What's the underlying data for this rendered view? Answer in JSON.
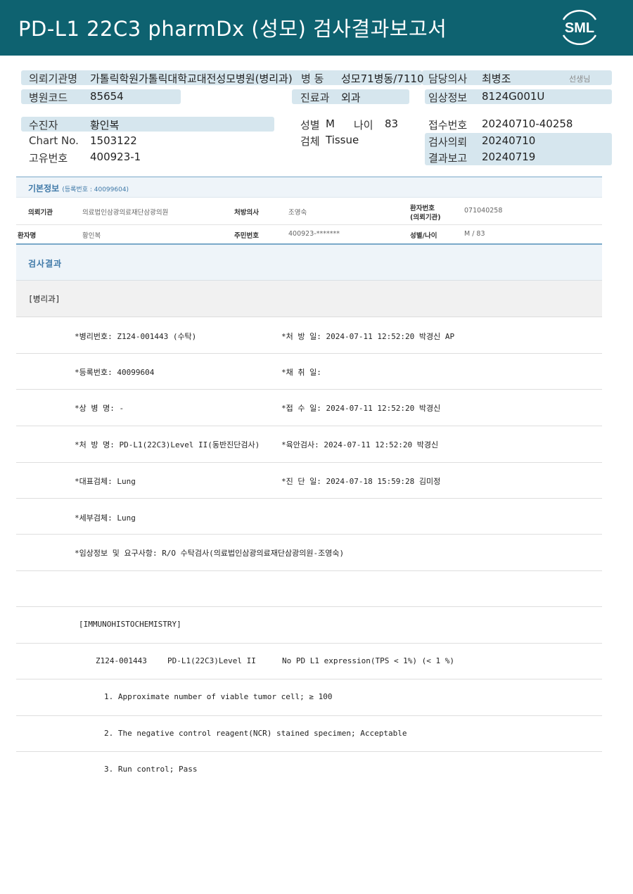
{
  "header": {
    "title": "PD-L1 22C3 pharmDx (성모) 검사결과보고서",
    "logo_text": "SML"
  },
  "summary": {
    "req_org_label": "의뢰기관명",
    "req_org_value": "가톨릭학원가톨릭대학교대전성모병원(병리과)",
    "ward_label": "병  동",
    "ward_value": "성모71병동/7110",
    "doctor_label": "담당의사",
    "doctor_value": "최병조",
    "doctor_suffix": "선생님",
    "hosp_code_label": "병원코드",
    "hosp_code_value": "85654",
    "dept_label": "진료과",
    "dept_value": "외과",
    "clinical_label": "임상정보",
    "clinical_value": "8124G001U",
    "patient_label": "수진자",
    "patient_value": "황인복",
    "sex_label": "성별",
    "sex_value": "M",
    "age_label": "나이",
    "age_value": "83",
    "receipt_label": "접수번호",
    "receipt_value": "20240710-40258",
    "chart_label": "Chart No.",
    "chart_value": "1503122",
    "specimen_label": "검체",
    "specimen_value": "Tissue",
    "test_req_label": "검사의뢰",
    "test_req_value": "20240710",
    "unique_label": "고유번호",
    "unique_value": "400923-1",
    "report_label": "결과보고",
    "report_value": "20240719"
  },
  "basic_info": {
    "title": "기본정보",
    "subtitle": "(등록번호 : 40099604)",
    "row1": {
      "org_label": "의뢰기관",
      "org_value": "의료법인삼광의료재단삼광의원",
      "prescriber_label": "처방의사",
      "prescriber_value": "조영숙",
      "patient_no_label_1": "환자번호",
      "patient_no_label_2": "(의뢰기관)",
      "patient_no_value": "071040258"
    },
    "row2": {
      "name_label": "환자명",
      "name_value": "황인복",
      "rrn_label": "주민번호",
      "rrn_value": "400923-*******",
      "sexage_label": "성별/나이",
      "sexage_value": "M / 83"
    }
  },
  "results": {
    "title": "검사결과",
    "department": "[병리과]",
    "lines": [
      {
        "left": "*병리번호: Z124-001443 (수탁)",
        "right": "*처 방 일: 2024-07-11 12:52:20  박경신 AP"
      },
      {
        "left": "*등록번호: 40099604",
        "right": "*채 취 일:"
      },
      {
        "left": "*상 병 명: -",
        "right": "*접 수 일: 2024-07-11 12:52:20  박경신"
      },
      {
        "left": "*처 방 명: PD-L1(22C3)Level II(동반진단검사)",
        "right": "*육안검사: 2024-07-11 12:52:20  박경신"
      },
      {
        "left": "*대표검체: Lung",
        "right": "*진 단 일: 2024-07-18 15:59:28  김미정"
      },
      {
        "left": "*세부검체: Lung",
        "right": ""
      },
      {
        "left": "*임상정보 및 요구사항: R/O 수탁검사(의료법인삼광의료재단삼광의원-조영숙)",
        "right": ""
      }
    ],
    "ihc_header": "[IMMUNOHISTOCHEMISTRY]",
    "ihc_id": "Z124-001443",
    "ihc_test": "PD-L1(22C3)Level II",
    "ihc_result": "No PD L1 expression(TPS < 1%) (< 1 %)",
    "notes": [
      "1. Approximate number of viable tumor cell; ≥ 100",
      "2. The negative control reagent(NCR) stained specimen; Acceptable",
      "3. Run control; Pass"
    ]
  }
}
